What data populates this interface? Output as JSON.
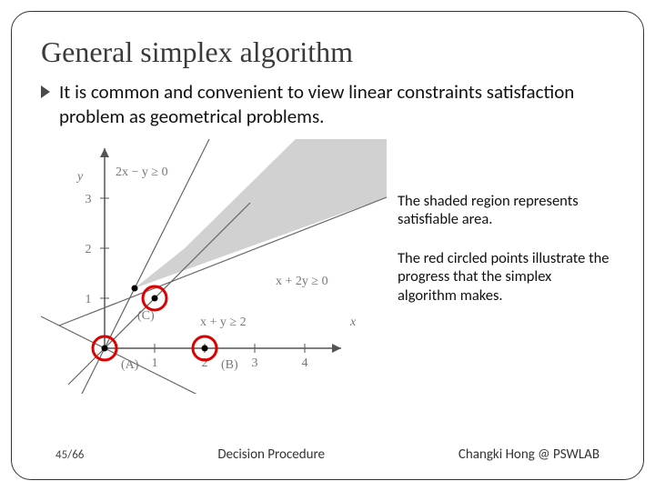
{
  "title": "General simplex algorithm",
  "bullet": "It is common and convenient to view linear constraints satisfaction problem as geometrical problems.",
  "caption1": "The shaded region represents satisfiable area.",
  "caption2": "The red circled points illustrate the progress that the simplex algorithm makes.",
  "figure": {
    "y_label": "y",
    "x_ticks": [
      "1",
      "2",
      "3",
      "4"
    ],
    "y_ticks": [
      "1",
      "2",
      "3"
    ],
    "constraint_top": "2x − y ≥ 0",
    "constraint_right": "x + 2y ≥ 0",
    "constraint_line": "x + y ≥ 2",
    "point_labels": [
      "(A)",
      "(B)",
      "(C)"
    ],
    "x_axis_label": "x"
  },
  "footer": {
    "page": "45/66",
    "center": "Decision Procedure",
    "right": "Changki Hong @ PSWLAB"
  }
}
